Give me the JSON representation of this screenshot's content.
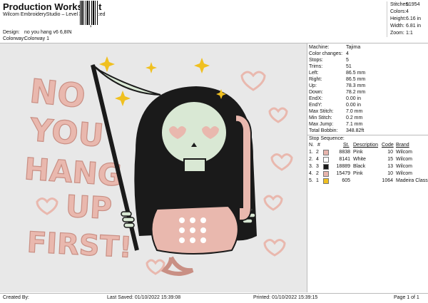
{
  "header": {
    "title": "Production Worksheet",
    "subtitle": "Wilcom EmbroideryStudio – Level 3 Advanced",
    "design_label": "Design:",
    "design_value": "no you hang v6 6,8IN",
    "colorway_label": "Colorway:",
    "colorway_value": "Colorway 1"
  },
  "stats": [
    {
      "label": "Stitches:",
      "value": "51954"
    },
    {
      "label": "Colors:",
      "value": "4"
    },
    {
      "label": "Height:",
      "value": "6.16 in"
    },
    {
      "label": "Width:",
      "value": "6.81 in"
    },
    {
      "label": "Zoom:",
      "value": "1:1"
    }
  ],
  "design": {
    "lettering": [
      "NO",
      "YOU",
      "HANG",
      "UP",
      "FIRST!"
    ],
    "colors": {
      "pink": "#e9b8ae",
      "pink_dark": "#c98f84",
      "black": "#1a1a1a",
      "white": "#f4f4f0",
      "gold": "#f0c020",
      "skull": "#d9e8d4"
    }
  },
  "machine_info": [
    {
      "label": "Machine:",
      "value": "Tajima"
    },
    {
      "label": "Color changes:",
      "value": "4"
    },
    {
      "label": "Stops:",
      "value": "5"
    },
    {
      "label": "Trims:",
      "value": "51"
    },
    {
      "label": "Left:",
      "value": "86.5 mm"
    },
    {
      "label": "Right:",
      "value": "86.5 mm"
    },
    {
      "label": "Up:",
      "value": "78.3 mm"
    },
    {
      "label": "Down:",
      "value": "78.2 mm"
    },
    {
      "label": "EndX:",
      "value": "0.00 in"
    },
    {
      "label": "EndY:",
      "value": "0.00 in"
    },
    {
      "label": "Max Stitch:",
      "value": "7.0 mm"
    },
    {
      "label": "Min Stitch:",
      "value": "0.2 mm"
    },
    {
      "label": "Max Jump:",
      "value": "7.1 mm"
    },
    {
      "label": "Total Bobbin:",
      "value": "348.82ft"
    }
  ],
  "sequence": {
    "title": "Stop Sequence:",
    "columns": [
      "N.",
      "#",
      "St.",
      "Description",
      "Code",
      "Brand"
    ],
    "rows": [
      {
        "n": "1.",
        "num": "2",
        "swatch": "#e8b5ad",
        "stitches": "8838",
        "description": "Pink",
        "code": "10",
        "brand": "Wilcom"
      },
      {
        "n": "2.",
        "num": "4",
        "swatch": "#ffffff",
        "stitches": "8141",
        "description": "White",
        "code": "15",
        "brand": "Wilcom"
      },
      {
        "n": "3.",
        "num": "3",
        "swatch": "#1a1a1a",
        "stitches": "18889",
        "description": "Black",
        "code": "13",
        "brand": "Wilcom"
      },
      {
        "n": "4.",
        "num": "2",
        "swatch": "#e8b5ad",
        "stitches": "15479",
        "description": "Pink",
        "code": "10",
        "brand": "Wilcom"
      },
      {
        "n": "5.",
        "num": "1",
        "swatch": "#f0c020",
        "stitches": "605",
        "description": "",
        "code": "1064",
        "brand": "Madeira Classic 40"
      }
    ]
  },
  "footer": {
    "created_by": "Created By:",
    "last_saved": "Last Saved: 01/10/2022 15:39:08",
    "printed": "Printed: 01/10/2022 15:39:15",
    "page": "Page 1 of 1"
  }
}
